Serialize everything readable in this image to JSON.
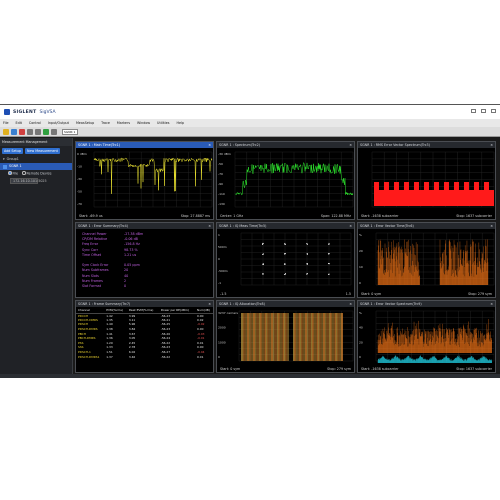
{
  "app": {
    "brand": "SIGLENT",
    "name": "SigVSA"
  },
  "menu": [
    "File",
    "Edit",
    "Control",
    "Input/Output",
    "MeasSetup",
    "Trace",
    "Markers",
    "Window",
    "Utilities",
    "Help"
  ],
  "toolbar": {
    "select_value": "SGNR 1"
  },
  "left_panel": {
    "title": "Measurement Management",
    "add_setup": "Add Setup",
    "new_measurement": "New Measurement",
    "group": "Group1",
    "item": "SGNR 1",
    "opt_file": "File",
    "opt_remote": "Remote Device",
    "field": "172.16.10.101:5025"
  },
  "panels": {
    "p1": {
      "title": "SGNR 1 : Main Time(Trc1)",
      "y_ticks": [
        "0 dBm",
        "-10",
        "-30",
        "-50",
        "-70"
      ],
      "start": "Start: -69.9 us",
      "stop": "Stop: 27.8887 ms"
    },
    "p2": {
      "title": "SGNR 1 : Spectrum(Trc2)",
      "y_ticks": [
        "-30 dBm",
        "-50",
        "-70",
        "-90",
        "-110",
        "-130"
      ],
      "start": "Center: 1 GHz",
      "stop": "Span: 122.88 MHz"
    },
    "p3": {
      "title": "SGNR 1 : RMS Error Vector Spectrum(Trc3)",
      "start": "Start: -1638 subcarrier",
      "stop": "Stop: 1637 subcarrier"
    },
    "p4": {
      "title": "SGNR 1 : Error Summary(Trc4)",
      "rows": [
        {
          "k": "Channel Power",
          "v": "-27.38 dBm"
        },
        {
          "k": "CP/DM Relative",
          "v": "-0.06 dB"
        },
        {
          "k": "Freq Error",
          "v": "-156.8 Hz"
        },
        {
          "k": "Sync Corr",
          "v": "98.73 %"
        },
        {
          "k": "Time Offset",
          "v": "1.21 us"
        },
        {
          "k": "",
          "v": ""
        },
        {
          "k": "Sym Clock Error",
          "v": "0.05 ppm"
        },
        {
          "k": "Num Subframes",
          "v": "20"
        },
        {
          "k": "Num Slots",
          "v": "40"
        },
        {
          "k": "Num Frames",
          "v": "2"
        },
        {
          "k": "Slot Format",
          "v": "0"
        }
      ]
    },
    "p5": {
      "title": "SGNR 1 : IQ Meas Time(Trc5)",
      "y_ticks": [
        "1",
        "500m",
        "0",
        "-500m",
        "-1"
      ],
      "start": "-1.5",
      "stop": "1.5"
    },
    "p6": {
      "title": "SGNR 1 : Error Vector Time(Trc6)",
      "y_ticks": [
        "%",
        "20",
        "10",
        "0"
      ],
      "start": "Start: 0 sym",
      "stop": "Stop: 279 sym"
    },
    "p7": {
      "title": "SGNR 1 : Frame Summary(Trc7)",
      "headers": [
        "Channel",
        "EVM(%rms)",
        "Peak EVM(%rms)",
        "Power per RE(dBm)",
        "Num(dB)"
      ],
      "rows": [
        [
          "PDCCH",
          "1.42",
          "3.99",
          "-56.23",
          "0.00"
        ],
        [
          "PDCCH-DMRS",
          "1.35",
          "3.11",
          "-56.21",
          "0.02"
        ],
        [
          "PDSCH",
          "1.49",
          "5.96",
          "-56.25",
          "-0.02"
        ],
        [
          "PDSCH-DMRS",
          "1.38",
          "3.84",
          "-56.23",
          "0.00"
        ],
        [
          "PBCH",
          "1.41",
          "3.67",
          "-56.26",
          "-0.03"
        ],
        [
          "PBCH-DMRS",
          "1.36",
          "3.05",
          "-56.24",
          "-0.01"
        ],
        [
          "PSS",
          "1.29",
          "2.45",
          "-56.22",
          "0.01"
        ],
        [
          "SSS",
          "1.33",
          "2.78",
          "-56.23",
          "0.00"
        ],
        [
          "PDSCH-1",
          "1.51",
          "6.02",
          "-56.27",
          "-0.04"
        ],
        [
          "PDSCH-DMRS1",
          "1.37",
          "3.46",
          "-56.22",
          "0.01"
        ]
      ]
    },
    "p8": {
      "title": "SGNR 1 : IQ Allocation(Trc8)",
      "y_ticks": [
        "3237 carriers",
        "2000",
        "1000",
        "0"
      ],
      "start": "Start: 0 sym",
      "stop": "Stop: 279 sym"
    },
    "p9": {
      "title": "SGNR 1 : Error Vector Spectrum(Trc9)",
      "y_ticks": [
        "%",
        "40",
        "20",
        "0"
      ],
      "start": "Start: -1638 subcarrier",
      "stop": "Stop: 1637 subcarrier"
    }
  },
  "colors": {
    "accent": "#2a5bb6",
    "yellow": "#e8e030",
    "green": "#2ee82e",
    "red": "#ff1a1a",
    "orange": "#ff7a1a",
    "cyan": "#22d3e6",
    "magenta": "#c060e0"
  }
}
